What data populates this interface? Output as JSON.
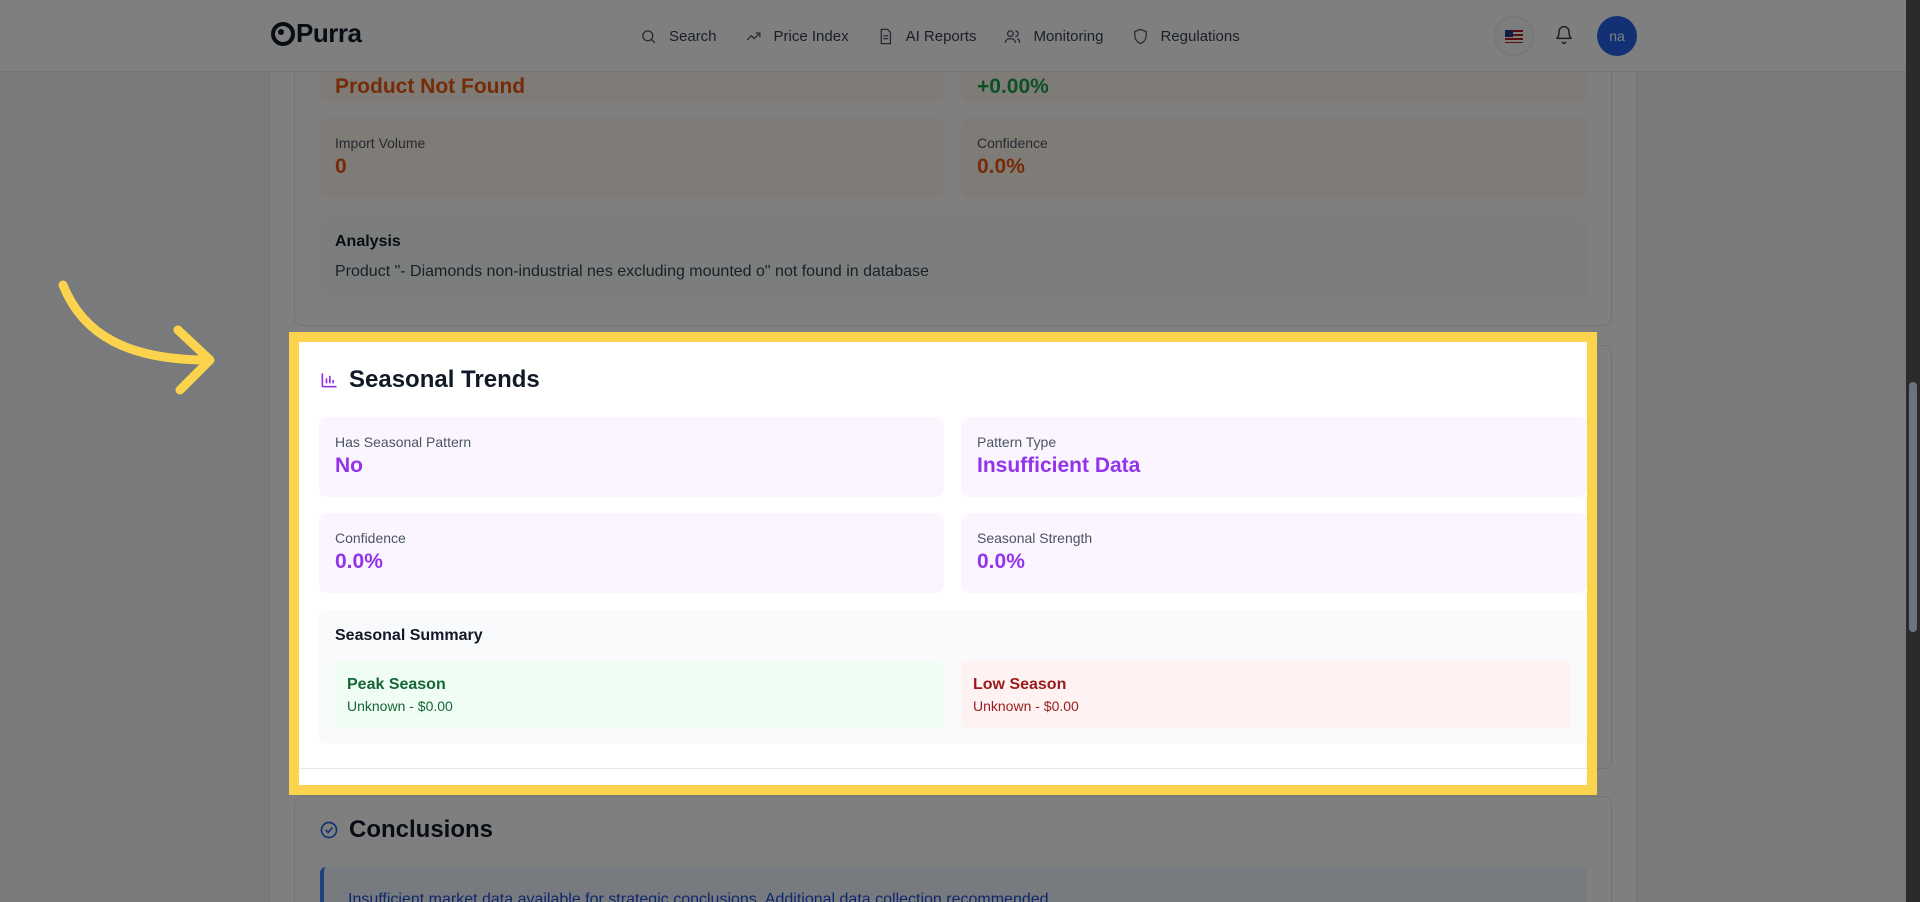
{
  "nav": {
    "logo": "Purra",
    "items": [
      {
        "label": "Search",
        "icon": "search-icon"
      },
      {
        "label": "Price Index",
        "icon": "trending-up-icon"
      },
      {
        "label": "AI Reports",
        "icon": "document-icon"
      },
      {
        "label": "Monitoring",
        "icon": "users-icon"
      },
      {
        "label": "Regulations",
        "icon": "shield-icon"
      }
    ],
    "avatar_initials": "na"
  },
  "market_analysis": {
    "product_status": "Product Not Found",
    "price_change": "+0.00%",
    "import_volume_label": "Import Volume",
    "import_volume_value": "0",
    "confidence_label": "Confidence",
    "confidence_value": "0.0%",
    "analysis_title": "Analysis",
    "analysis_text": "Product \"- Diamonds non-industrial nes excluding mounted o\" not found in database"
  },
  "seasonal_trends": {
    "title": "Seasonal Trends",
    "has_pattern_label": "Has Seasonal Pattern",
    "has_pattern_value": "No",
    "pattern_type_label": "Pattern Type",
    "pattern_type_value": "Insufficient Data",
    "confidence_label": "Confidence",
    "confidence_value": "0.0%",
    "strength_label": "Seasonal Strength",
    "strength_value": "0.0%",
    "summary_title": "Seasonal Summary",
    "peak_title": "Peak Season",
    "peak_value": "Unknown - $0.00",
    "low_title": "Low Season",
    "low_value": "Unknown - $0.00"
  },
  "conclusions": {
    "title": "Conclusions",
    "text": "Insufficient market data available for strategic conclusions. Additional data collection recommended."
  },
  "colors": {
    "highlight": "#fcd34d",
    "accent_purple": "#9333ea",
    "accent_orange": "#ea580c",
    "accent_green": "#16a34a",
    "avatar_blue": "#2563eb"
  }
}
